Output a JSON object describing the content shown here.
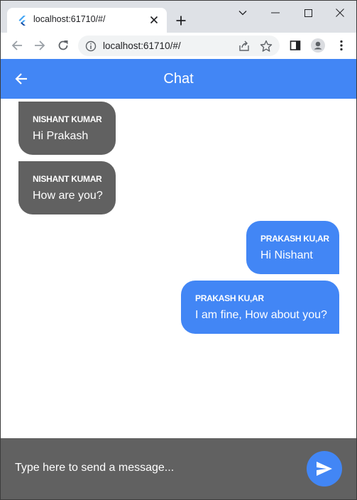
{
  "browser": {
    "tab_title": "localhost:61710/#/",
    "url": "localhost:61710/#/"
  },
  "appbar": {
    "title": "Chat"
  },
  "messages": [
    {
      "direction": "incoming",
      "sender": "NISHANT KUMAR",
      "text": "Hi Prakash"
    },
    {
      "direction": "incoming",
      "sender": "NISHANT KUMAR",
      "text": "How are you?"
    },
    {
      "direction": "outgoing",
      "sender": "PRAKASH KU,AR",
      "text": "Hi Nishant"
    },
    {
      "direction": "outgoing",
      "sender": "PRAKASH KU,AR",
      "text": "I am fine, How about you?"
    }
  ],
  "composer": {
    "placeholder": "Type here to send a message..."
  },
  "colors": {
    "primary": "#4286f5",
    "incoming_bubble": "#616161",
    "composer_bg": "#616161"
  },
  "icons": {
    "favicon": "flutter-icon",
    "back": "arrow-left-icon",
    "send": "send-icon"
  }
}
